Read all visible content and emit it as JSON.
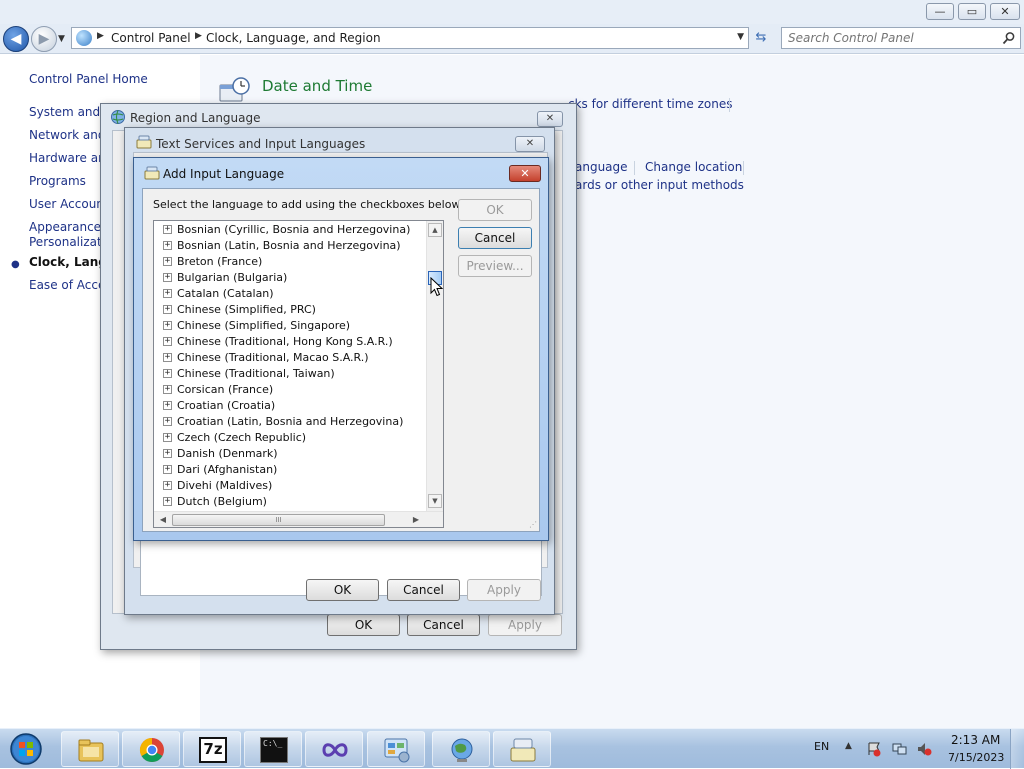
{
  "window": {
    "minimize_glyph": "—",
    "maximize_glyph": "▭",
    "close_glyph": "✕"
  },
  "address": {
    "crumbs": [
      "Control Panel",
      "Clock, Language, and Region"
    ],
    "search_placeholder": "Search Control Panel"
  },
  "sidebar": {
    "home": "Control Panel Home",
    "items": [
      {
        "label": "System and S"
      },
      {
        "label": "Network and"
      },
      {
        "label": "Hardware and"
      },
      {
        "label": "Programs"
      },
      {
        "label": "User Account"
      },
      {
        "label": "Appearance a"
      },
      {
        "label": "Personalizati"
      },
      {
        "label": "Clock, Langua"
      },
      {
        "label": "Ease of Acces"
      }
    ]
  },
  "content": {
    "date_time_title": "Date and Time",
    "link_time_zones": "cks for different time zones",
    "link_language": "anguage",
    "link_change_location": "Change location",
    "link_keyboards": "ards or other input methods"
  },
  "region_dialog": {
    "title": "Region and Language",
    "ok": "OK",
    "cancel": "Cancel",
    "apply": "Apply"
  },
  "text_services_dialog": {
    "title": "Text Services and Input Languages",
    "ok": "OK",
    "cancel": "Cancel",
    "apply": "Apply"
  },
  "add_language_dialog": {
    "title": "Add Input Language",
    "instruction": "Select the language to add using the checkboxes below.",
    "ok": "OK",
    "cancel": "Cancel",
    "preview": "Preview...",
    "languages": [
      "Bosnian (Cyrillic, Bosnia and Herzegovina)",
      "Bosnian (Latin, Bosnia and Herzegovina)",
      "Breton (France)",
      "Bulgarian (Bulgaria)",
      "Catalan (Catalan)",
      "Chinese (Simplified, PRC)",
      "Chinese (Simplified, Singapore)",
      "Chinese (Traditional, Hong Kong S.A.R.)",
      "Chinese (Traditional, Macao S.A.R.)",
      "Chinese (Traditional, Taiwan)",
      "Corsican (France)",
      "Croatian (Croatia)",
      "Croatian (Latin, Bosnia and Herzegovina)",
      "Czech (Czech Republic)",
      "Danish (Denmark)",
      "Dari (Afghanistan)",
      "Divehi (Maldives)",
      "Dutch (Belgium)"
    ],
    "expander_glyph": "+",
    "hscroll_grip": "III"
  },
  "taskbar": {
    "items": [
      "explorer-icon",
      "chrome-icon",
      "7zip-icon",
      "cmd-icon",
      "infinity-app-icon",
      "control-panel-icon",
      "region-globe-icon",
      "keyboard-icon"
    ],
    "seven_zip_label": "7z",
    "cmd_label": "C:\\_",
    "tray_lang": "EN",
    "clock_time": "2:13 AM",
    "clock_date": "7/15/2023"
  }
}
